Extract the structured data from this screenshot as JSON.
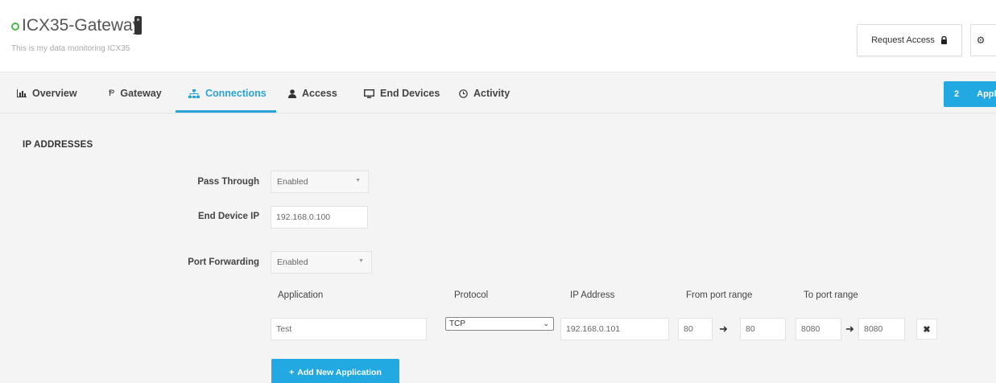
{
  "header": {
    "device_name": "ICX35-Gateway",
    "description": "This is my data monitoring ICX35",
    "request_access_label": "Request Access",
    "status_color": "#4cb848"
  },
  "tabs": [
    {
      "label": "Overview",
      "icon": "bar-chart-icon"
    },
    {
      "label": "Gateway",
      "icon": "gateway-icon"
    },
    {
      "label": "Connections",
      "icon": "sitemap-icon",
      "active": true
    },
    {
      "label": "Access",
      "icon": "user-icon"
    },
    {
      "label": "End Devices",
      "icon": "monitor-icon"
    },
    {
      "label": "Activity",
      "icon": "clock-icon"
    }
  ],
  "apply": {
    "count": "2",
    "label": "Appl"
  },
  "section": {
    "title": "IP ADDRESSES"
  },
  "form": {
    "pass_through_label": "Pass Through",
    "pass_through_value": "Enabled",
    "end_device_ip_label": "End Device IP",
    "end_device_ip_value": "192.168.0.100",
    "port_forwarding_label": "Port Forwarding",
    "port_forwarding_value": "Enabled"
  },
  "port_table": {
    "headers": [
      "Application",
      "Protocol",
      "IP Address",
      "From port range",
      "To port range"
    ],
    "rows": [
      {
        "application": "Test",
        "protocol": "TCP",
        "ip": "192.168.0.101",
        "from_start": "80",
        "from_end": "80",
        "to_start": "8080",
        "to_end": "8080"
      }
    ]
  },
  "add_button_label": "Add New Application",
  "accent_color": "#23a9e1"
}
